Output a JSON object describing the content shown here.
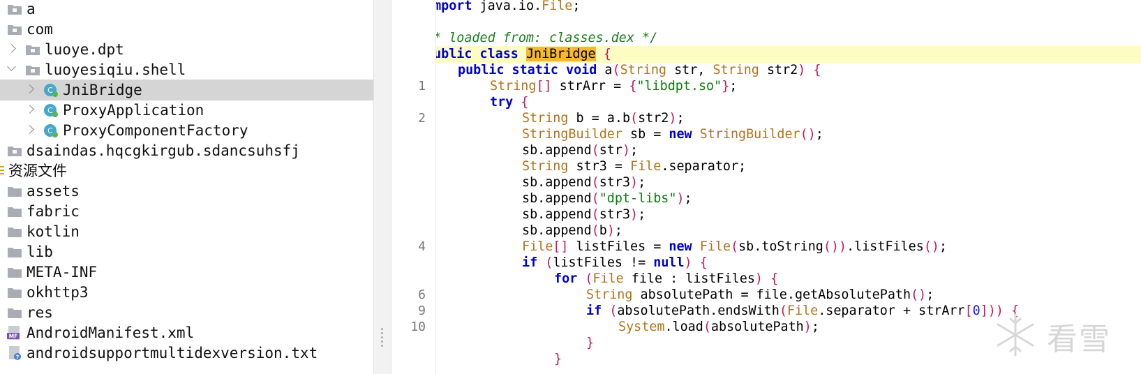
{
  "tree": {
    "items": [
      {
        "label": "a",
        "kind": "package",
        "chevron": "none"
      },
      {
        "label": "com",
        "kind": "package",
        "chevron": "none"
      },
      {
        "label": "luoye.dpt",
        "kind": "package",
        "chevron": "right"
      },
      {
        "label": "luoyesiqiu.shell",
        "kind": "package",
        "chevron": "down"
      },
      {
        "label": "JniBridge",
        "kind": "class",
        "chevron": "right",
        "selected": true
      },
      {
        "label": "ProxyApplication",
        "kind": "class",
        "chevron": "right"
      },
      {
        "label": "ProxyComponentFactory",
        "kind": "class",
        "chevron": "right"
      },
      {
        "label": "dsaindas.hqcgkirgub.sdancsuhsfj",
        "kind": "package",
        "chevron": "none"
      },
      {
        "label": "资源文件",
        "kind": "resources",
        "chevron": "none"
      },
      {
        "label": "assets",
        "kind": "folder",
        "chevron": "none"
      },
      {
        "label": "fabric",
        "kind": "folder",
        "chevron": "none"
      },
      {
        "label": "kotlin",
        "kind": "folder",
        "chevron": "none"
      },
      {
        "label": "lib",
        "kind": "folder",
        "chevron": "none"
      },
      {
        "label": "META-INF",
        "kind": "folder",
        "chevron": "none"
      },
      {
        "label": "okhttp3",
        "kind": "folder",
        "chevron": "none"
      },
      {
        "label": "res",
        "kind": "folder",
        "chevron": "none"
      },
      {
        "label": "AndroidManifest.xml",
        "kind": "manifest",
        "chevron": "none"
      },
      {
        "label": "androidsupportmultidexversion.txt",
        "kind": "unknown-file",
        "chevron": "none"
      }
    ]
  },
  "gutter": {
    "line_numbers": [
      "",
      "",
      "",
      "",
      "",
      "1",
      "",
      "2",
      "",
      "",
      "",
      "",
      "",
      "",
      "",
      "4",
      "",
      "",
      "6",
      "9",
      "10",
      "",
      ""
    ]
  },
  "code": {
    "lines": [
      {
        "t": "import java.io.File;",
        "indent": 0
      },
      {
        "t": "",
        "indent": 0
      },
      {
        "t": "/* loaded from: classes.dex */",
        "indent": 0
      },
      {
        "t": "public class JniBridge {",
        "indent": 0,
        "highlight": true
      },
      {
        "t": "public static void a(String str, String str2) {",
        "indent": 1
      },
      {
        "t": "String[] strArr = {\"libdpt.so\"};",
        "indent": 2
      },
      {
        "t": "try {",
        "indent": 2
      },
      {
        "t": "String b = a.b(str2);",
        "indent": 3
      },
      {
        "t": "StringBuilder sb = new StringBuilder();",
        "indent": 3
      },
      {
        "t": "sb.append(str);",
        "indent": 3
      },
      {
        "t": "String str3 = File.separator;",
        "indent": 3
      },
      {
        "t": "sb.append(str3);",
        "indent": 3
      },
      {
        "t": "sb.append(\"dpt-libs\");",
        "indent": 3
      },
      {
        "t": "sb.append(str3);",
        "indent": 3
      },
      {
        "t": "sb.append(b);",
        "indent": 3
      },
      {
        "t": "File[] listFiles = new File(sb.toString()).listFiles();",
        "indent": 3
      },
      {
        "t": "if (listFiles != null) {",
        "indent": 3
      },
      {
        "t": "for (File file : listFiles) {",
        "indent": 4
      },
      {
        "t": "String absolutePath = file.getAbsolutePath();",
        "indent": 5
      },
      {
        "t": "if (absolutePath.endsWith(File.separator + strArr[0])) {",
        "indent": 5
      },
      {
        "t": "System.load(absolutePath);",
        "indent": 6
      },
      {
        "t": "}",
        "indent": 5
      },
      {
        "t": "}",
        "indent": 4
      }
    ],
    "selected_identifier": "JniBridge"
  },
  "watermark": {
    "text": "看雪"
  },
  "colors": {
    "keyword": "#0000cc",
    "type": "#b0741a",
    "string": "#0a7a0a",
    "comment": "#1a7e1a",
    "paren": "#c2185b",
    "number": "#1a1aee",
    "line_highlight": "#fdfcc2",
    "selection": "#f5b830",
    "tree_selection": "#d5d5d5"
  }
}
